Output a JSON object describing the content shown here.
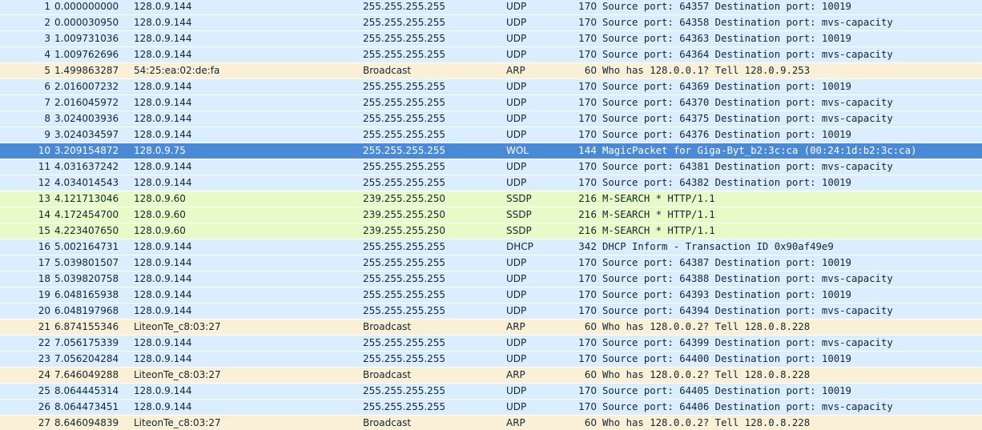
{
  "colors": {
    "UDP": "#daeeff",
    "ARP": "#faf0d7",
    "SSDP": "#e7fbc9",
    "DHCP": "#daeeff",
    "WOL": "#daeeff",
    "selected": "#4a89d6"
  },
  "packets": [
    {
      "no": "1",
      "time": "0.000000000",
      "src": "128.0.9.144",
      "dst": "255.255.255.255",
      "proto": "UDP",
      "len": "170",
      "info": "Source port: 64357  Destination port: 10019"
    },
    {
      "no": "2",
      "time": "0.000030950",
      "src": "128.0.9.144",
      "dst": "255.255.255.255",
      "proto": "UDP",
      "len": "170",
      "info": "Source port: 64358  Destination port: mvs-capacity"
    },
    {
      "no": "3",
      "time": "1.009731036",
      "src": "128.0.9.144",
      "dst": "255.255.255.255",
      "proto": "UDP",
      "len": "170",
      "info": "Source port: 64363  Destination port: 10019"
    },
    {
      "no": "4",
      "time": "1.009762696",
      "src": "128.0.9.144",
      "dst": "255.255.255.255",
      "proto": "UDP",
      "len": "170",
      "info": "Source port: 64364  Destination port: mvs-capacity"
    },
    {
      "no": "5",
      "time": "1.499863287",
      "src": "54:25:ea:02:de:fa",
      "dst": "Broadcast",
      "proto": "ARP",
      "len": "60",
      "info": "Who has 128.0.0.1?  Tell 128.0.9.253"
    },
    {
      "no": "6",
      "time": "2.016007232",
      "src": "128.0.9.144",
      "dst": "255.255.255.255",
      "proto": "UDP",
      "len": "170",
      "info": "Source port: 64369  Destination port: 10019"
    },
    {
      "no": "7",
      "time": "2.016045972",
      "src": "128.0.9.144",
      "dst": "255.255.255.255",
      "proto": "UDP",
      "len": "170",
      "info": "Source port: 64370  Destination port: mvs-capacity"
    },
    {
      "no": "8",
      "time": "3.024003936",
      "src": "128.0.9.144",
      "dst": "255.255.255.255",
      "proto": "UDP",
      "len": "170",
      "info": "Source port: 64375  Destination port: mvs-capacity"
    },
    {
      "no": "9",
      "time": "3.024034597",
      "src": "128.0.9.144",
      "dst": "255.255.255.255",
      "proto": "UDP",
      "len": "170",
      "info": "Source port: 64376  Destination port: 10019"
    },
    {
      "no": "10",
      "time": "3.209154872",
      "src": "128.0.9.75",
      "dst": "255.255.255.255",
      "proto": "WOL",
      "len": "144",
      "info": "MagicPacket for Giga-Byt_b2:3c:ca (00:24:1d:b2:3c:ca)",
      "selected": true
    },
    {
      "no": "11",
      "time": "4.031637242",
      "src": "128.0.9.144",
      "dst": "255.255.255.255",
      "proto": "UDP",
      "len": "170",
      "info": "Source port: 64381  Destination port: mvs-capacity"
    },
    {
      "no": "12",
      "time": "4.034014543",
      "src": "128.0.9.144",
      "dst": "255.255.255.255",
      "proto": "UDP",
      "len": "170",
      "info": "Source port: 64382  Destination port: 10019"
    },
    {
      "no": "13",
      "time": "4.121713046",
      "src": "128.0.9.60",
      "dst": "239.255.255.250",
      "proto": "SSDP",
      "len": "216",
      "info": "M-SEARCH * HTTP/1.1"
    },
    {
      "no": "14",
      "time": "4.172454700",
      "src": "128.0.9.60",
      "dst": "239.255.255.250",
      "proto": "SSDP",
      "len": "216",
      "info": "M-SEARCH * HTTP/1.1"
    },
    {
      "no": "15",
      "time": "4.223407650",
      "src": "128.0.9.60",
      "dst": "239.255.255.250",
      "proto": "SSDP",
      "len": "216",
      "info": "M-SEARCH * HTTP/1.1"
    },
    {
      "no": "16",
      "time": "5.002164731",
      "src": "128.0.9.144",
      "dst": "255.255.255.255",
      "proto": "DHCP",
      "len": "342",
      "info": "DHCP Inform   - Transaction ID 0x90af49e9"
    },
    {
      "no": "17",
      "time": "5.039801507",
      "src": "128.0.9.144",
      "dst": "255.255.255.255",
      "proto": "UDP",
      "len": "170",
      "info": "Source port: 64387  Destination port: 10019"
    },
    {
      "no": "18",
      "time": "5.039820758",
      "src": "128.0.9.144",
      "dst": "255.255.255.255",
      "proto": "UDP",
      "len": "170",
      "info": "Source port: 64388  Destination port: mvs-capacity"
    },
    {
      "no": "19",
      "time": "6.048165938",
      "src": "128.0.9.144",
      "dst": "255.255.255.255",
      "proto": "UDP",
      "len": "170",
      "info": "Source port: 64393  Destination port: 10019"
    },
    {
      "no": "20",
      "time": "6.048197968",
      "src": "128.0.9.144",
      "dst": "255.255.255.255",
      "proto": "UDP",
      "len": "170",
      "info": "Source port: 64394  Destination port: mvs-capacity"
    },
    {
      "no": "21",
      "time": "6.874155346",
      "src": "LiteonTe_c8:03:27",
      "dst": "Broadcast",
      "proto": "ARP",
      "len": "60",
      "info": "Who has 128.0.0.2?  Tell 128.0.8.228"
    },
    {
      "no": "22",
      "time": "7.056175339",
      "src": "128.0.9.144",
      "dst": "255.255.255.255",
      "proto": "UDP",
      "len": "170",
      "info": "Source port: 64399  Destination port: mvs-capacity"
    },
    {
      "no": "23",
      "time": "7.056204284",
      "src": "128.0.9.144",
      "dst": "255.255.255.255",
      "proto": "UDP",
      "len": "170",
      "info": "Source port: 64400  Destination port: 10019"
    },
    {
      "no": "24",
      "time": "7.646049288",
      "src": "LiteonTe_c8:03:27",
      "dst": "Broadcast",
      "proto": "ARP",
      "len": "60",
      "info": "Who has 128.0.0.2?  Tell 128.0.8.228"
    },
    {
      "no": "25",
      "time": "8.064445314",
      "src": "128.0.9.144",
      "dst": "255.255.255.255",
      "proto": "UDP",
      "len": "170",
      "info": "Source port: 64405  Destination port: 10019"
    },
    {
      "no": "26",
      "time": "8.064473451",
      "src": "128.0.9.144",
      "dst": "255.255.255.255",
      "proto": "UDP",
      "len": "170",
      "info": "Source port: 64406  Destination port: mvs-capacity"
    },
    {
      "no": "27",
      "time": "8.646094839",
      "src": "LiteonTe_c8:03:27",
      "dst": "Broadcast",
      "proto": "ARP",
      "len": "60",
      "info": "Who has 128.0.0.2?  Tell 128.0.8.228"
    }
  ]
}
